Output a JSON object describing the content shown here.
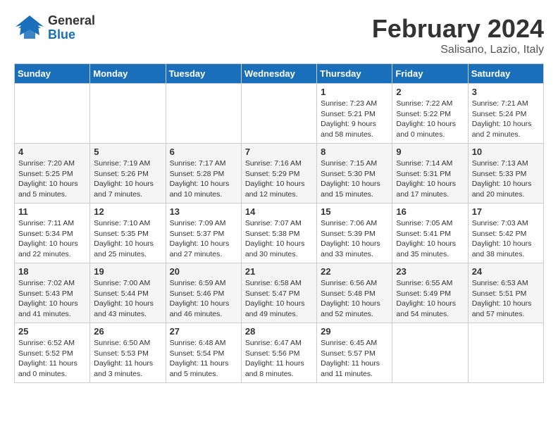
{
  "header": {
    "logo_line1": "General",
    "logo_line2": "Blue",
    "title": "February 2024",
    "location": "Salisano, Lazio, Italy"
  },
  "calendar": {
    "days_of_week": [
      "Sunday",
      "Monday",
      "Tuesday",
      "Wednesday",
      "Thursday",
      "Friday",
      "Saturday"
    ],
    "weeks": [
      [
        {
          "day": "",
          "info": ""
        },
        {
          "day": "",
          "info": ""
        },
        {
          "day": "",
          "info": ""
        },
        {
          "day": "",
          "info": ""
        },
        {
          "day": "1",
          "info": "Sunrise: 7:23 AM\nSunset: 5:21 PM\nDaylight: 9 hours\nand 58 minutes."
        },
        {
          "day": "2",
          "info": "Sunrise: 7:22 AM\nSunset: 5:22 PM\nDaylight: 10 hours\nand 0 minutes."
        },
        {
          "day": "3",
          "info": "Sunrise: 7:21 AM\nSunset: 5:24 PM\nDaylight: 10 hours\nand 2 minutes."
        }
      ],
      [
        {
          "day": "4",
          "info": "Sunrise: 7:20 AM\nSunset: 5:25 PM\nDaylight: 10 hours\nand 5 minutes."
        },
        {
          "day": "5",
          "info": "Sunrise: 7:19 AM\nSunset: 5:26 PM\nDaylight: 10 hours\nand 7 minutes."
        },
        {
          "day": "6",
          "info": "Sunrise: 7:17 AM\nSunset: 5:28 PM\nDaylight: 10 hours\nand 10 minutes."
        },
        {
          "day": "7",
          "info": "Sunrise: 7:16 AM\nSunset: 5:29 PM\nDaylight: 10 hours\nand 12 minutes."
        },
        {
          "day": "8",
          "info": "Sunrise: 7:15 AM\nSunset: 5:30 PM\nDaylight: 10 hours\nand 15 minutes."
        },
        {
          "day": "9",
          "info": "Sunrise: 7:14 AM\nSunset: 5:31 PM\nDaylight: 10 hours\nand 17 minutes."
        },
        {
          "day": "10",
          "info": "Sunrise: 7:13 AM\nSunset: 5:33 PM\nDaylight: 10 hours\nand 20 minutes."
        }
      ],
      [
        {
          "day": "11",
          "info": "Sunrise: 7:11 AM\nSunset: 5:34 PM\nDaylight: 10 hours\nand 22 minutes."
        },
        {
          "day": "12",
          "info": "Sunrise: 7:10 AM\nSunset: 5:35 PM\nDaylight: 10 hours\nand 25 minutes."
        },
        {
          "day": "13",
          "info": "Sunrise: 7:09 AM\nSunset: 5:37 PM\nDaylight: 10 hours\nand 27 minutes."
        },
        {
          "day": "14",
          "info": "Sunrise: 7:07 AM\nSunset: 5:38 PM\nDaylight: 10 hours\nand 30 minutes."
        },
        {
          "day": "15",
          "info": "Sunrise: 7:06 AM\nSunset: 5:39 PM\nDaylight: 10 hours\nand 33 minutes."
        },
        {
          "day": "16",
          "info": "Sunrise: 7:05 AM\nSunset: 5:41 PM\nDaylight: 10 hours\nand 35 minutes."
        },
        {
          "day": "17",
          "info": "Sunrise: 7:03 AM\nSunset: 5:42 PM\nDaylight: 10 hours\nand 38 minutes."
        }
      ],
      [
        {
          "day": "18",
          "info": "Sunrise: 7:02 AM\nSunset: 5:43 PM\nDaylight: 10 hours\nand 41 minutes."
        },
        {
          "day": "19",
          "info": "Sunrise: 7:00 AM\nSunset: 5:44 PM\nDaylight: 10 hours\nand 43 minutes."
        },
        {
          "day": "20",
          "info": "Sunrise: 6:59 AM\nSunset: 5:46 PM\nDaylight: 10 hours\nand 46 minutes."
        },
        {
          "day": "21",
          "info": "Sunrise: 6:58 AM\nSunset: 5:47 PM\nDaylight: 10 hours\nand 49 minutes."
        },
        {
          "day": "22",
          "info": "Sunrise: 6:56 AM\nSunset: 5:48 PM\nDaylight: 10 hours\nand 52 minutes."
        },
        {
          "day": "23",
          "info": "Sunrise: 6:55 AM\nSunset: 5:49 PM\nDaylight: 10 hours\nand 54 minutes."
        },
        {
          "day": "24",
          "info": "Sunrise: 6:53 AM\nSunset: 5:51 PM\nDaylight: 10 hours\nand 57 minutes."
        }
      ],
      [
        {
          "day": "25",
          "info": "Sunrise: 6:52 AM\nSunset: 5:52 PM\nDaylight: 11 hours\nand 0 minutes."
        },
        {
          "day": "26",
          "info": "Sunrise: 6:50 AM\nSunset: 5:53 PM\nDaylight: 11 hours\nand 3 minutes."
        },
        {
          "day": "27",
          "info": "Sunrise: 6:48 AM\nSunset: 5:54 PM\nDaylight: 11 hours\nand 5 minutes."
        },
        {
          "day": "28",
          "info": "Sunrise: 6:47 AM\nSunset: 5:56 PM\nDaylight: 11 hours\nand 8 minutes."
        },
        {
          "day": "29",
          "info": "Sunrise: 6:45 AM\nSunset: 5:57 PM\nDaylight: 11 hours\nand 11 minutes."
        },
        {
          "day": "",
          "info": ""
        },
        {
          "day": "",
          "info": ""
        }
      ]
    ]
  }
}
